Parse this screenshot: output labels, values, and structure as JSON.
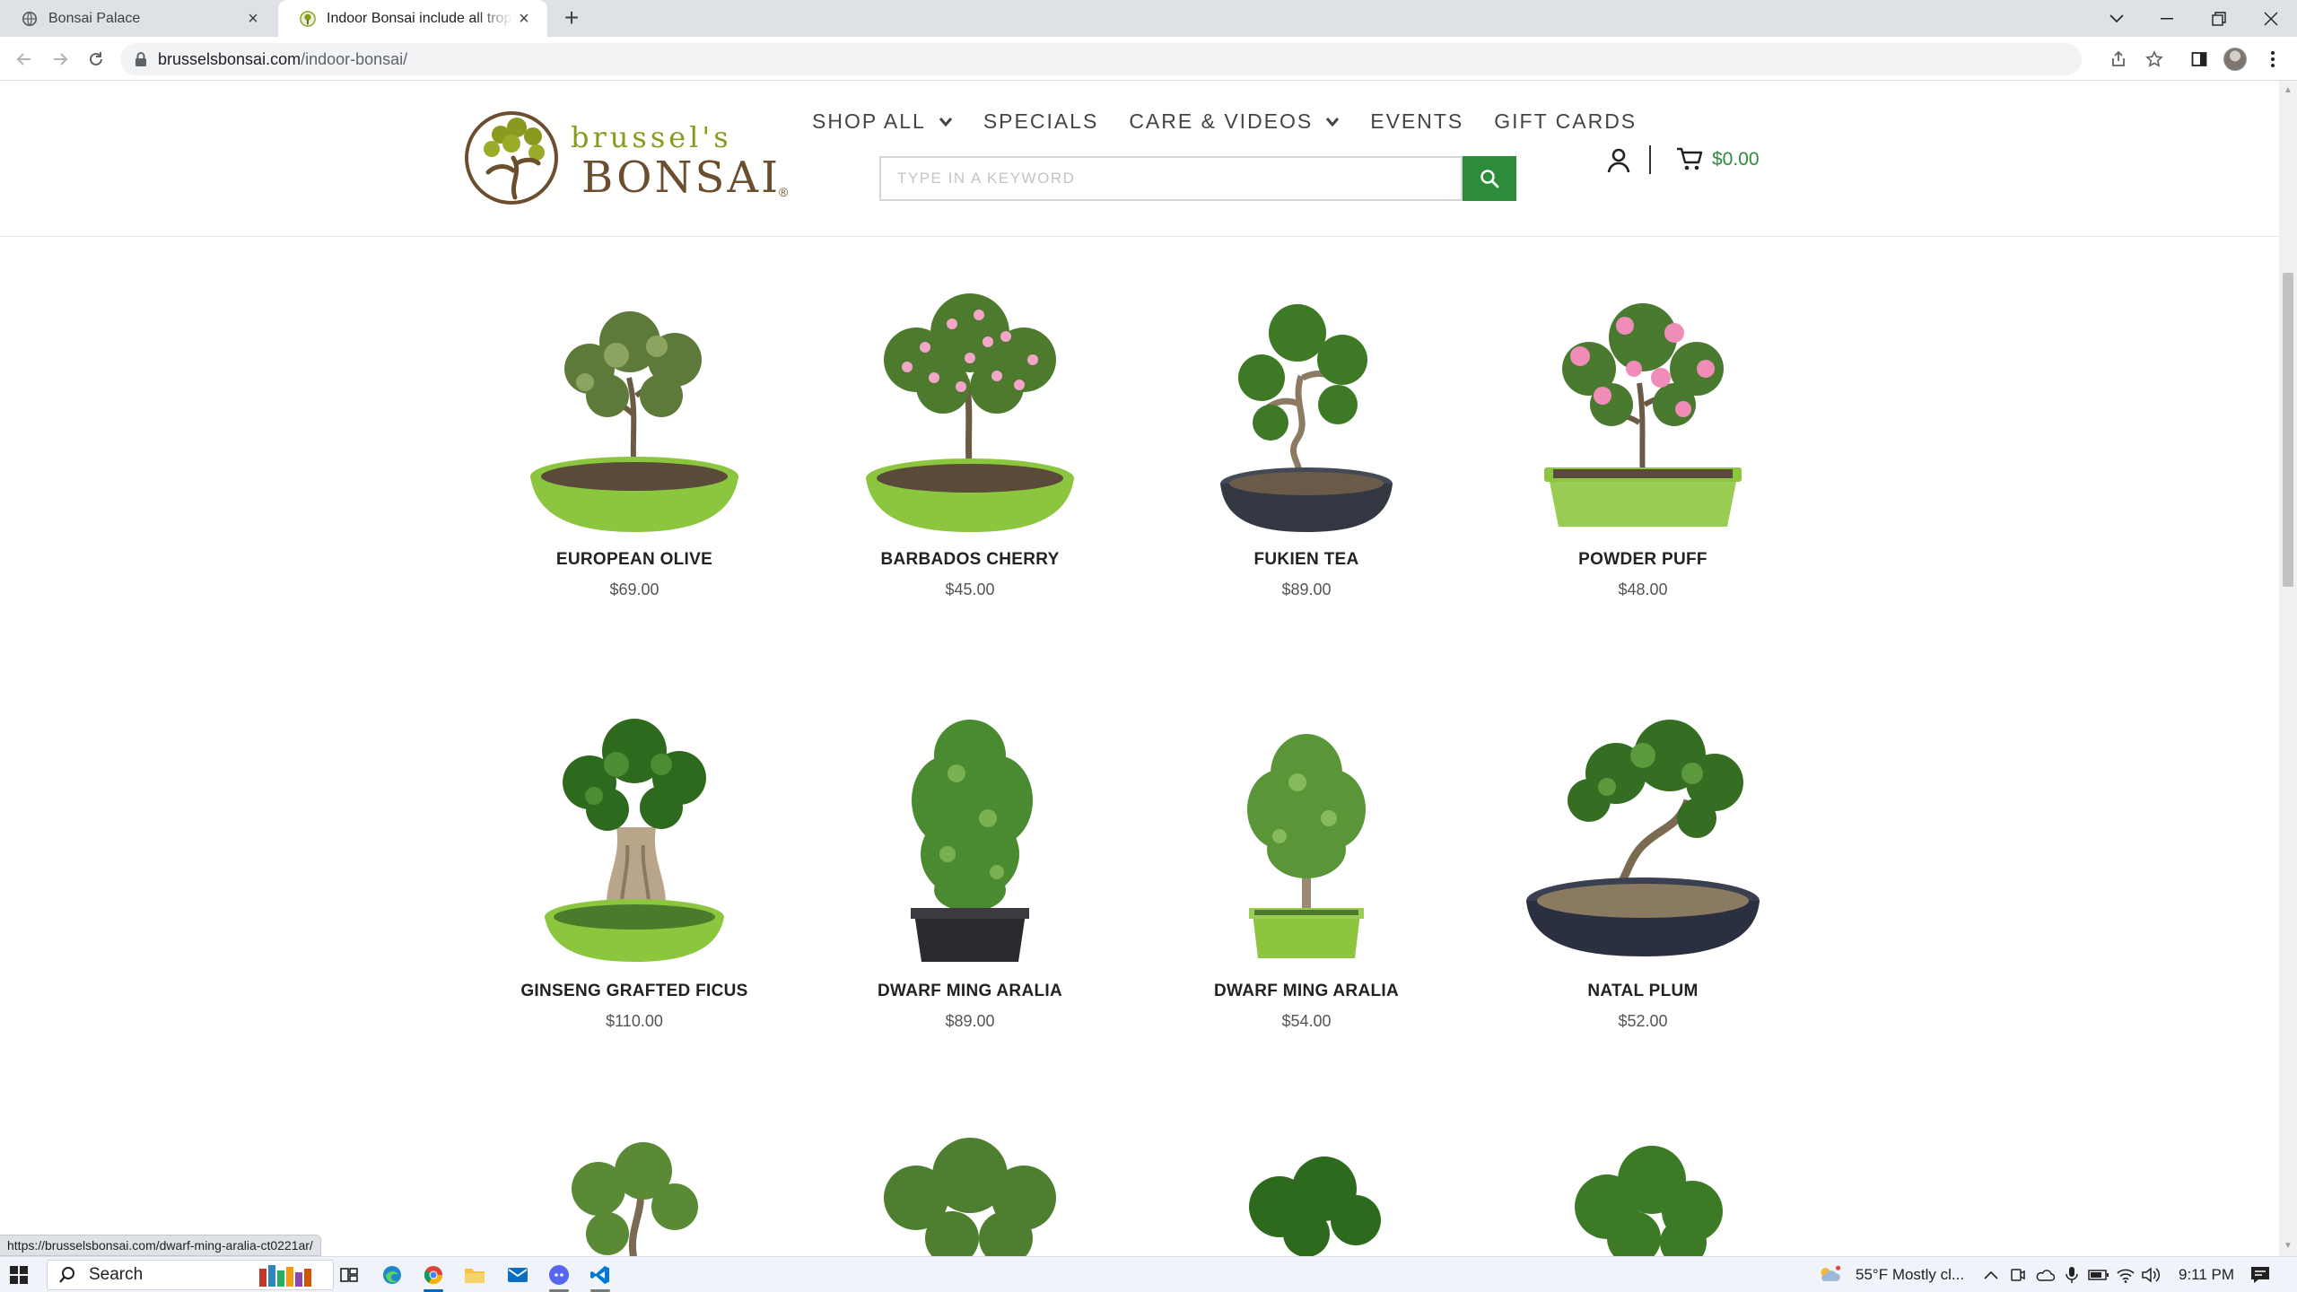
{
  "browser": {
    "tabs": [
      {
        "title": "Bonsai Palace",
        "active": false
      },
      {
        "title": "Indoor Bonsai include all tropical",
        "active": true
      }
    ],
    "new_tab_label": "+",
    "url_host": "brusselsbonsai.com",
    "url_path": "/indoor-bonsai/",
    "status_url": "https://brusselsbonsai.com/dwarf-ming-aralia-ct0221ar/"
  },
  "site": {
    "logo_top": "brussel's",
    "logo_main": "BONSAI",
    "logo_reg": "®",
    "nav": [
      {
        "label": "SHOP ALL",
        "has_dropdown": true
      },
      {
        "label": "SPECIALS",
        "has_dropdown": false
      },
      {
        "label": "CARE & VIDEOS",
        "has_dropdown": true
      },
      {
        "label": "EVENTS",
        "has_dropdown": false
      },
      {
        "label": "GIFT CARDS",
        "has_dropdown": false
      }
    ],
    "search_placeholder": "TYPE IN A KEYWORD",
    "cart_total": "$0.00",
    "accent_color": "#2d8c3c"
  },
  "products": [
    {
      "name": "EUROPEAN OLIVE",
      "price": "$69.00",
      "pot": "green-round",
      "foliage": "olive"
    },
    {
      "name": "BARBADOS CHERRY",
      "price": "$45.00",
      "pot": "green-round",
      "foliage": "pink-flower"
    },
    {
      "name": "FUKIEN TEA",
      "price": "$89.00",
      "pot": "dark-round",
      "foliage": "green"
    },
    {
      "name": "POWDER PUFF",
      "price": "$48.00",
      "pot": "green-rect",
      "foliage": "pink-flower"
    },
    {
      "name": "GINSENG GRAFTED FICUS",
      "price": "$110.00",
      "pot": "green-round",
      "foliage": "green"
    },
    {
      "name": "DWARF MING ARALIA",
      "price": "$89.00",
      "pot": "dark-rect",
      "foliage": "fern"
    },
    {
      "name": "DWARF MING ARALIA",
      "price": "$54.00",
      "pot": "green-rect",
      "foliage": "fern"
    },
    {
      "name": "NATAL PLUM",
      "price": "$52.00",
      "pot": "dark-round",
      "foliage": "green"
    }
  ],
  "taskbar": {
    "search_label": "Search",
    "weather": "55°F  Mostly cl...",
    "time": "9:11 PM"
  }
}
